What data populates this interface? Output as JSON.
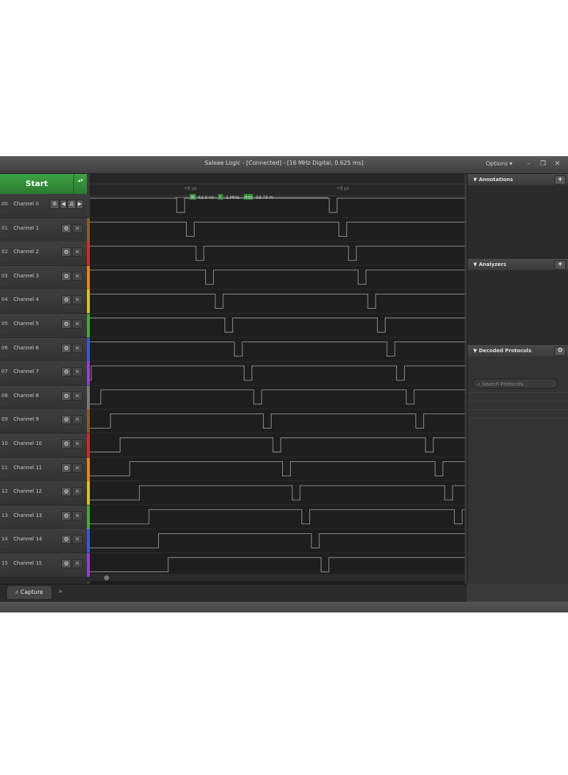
{
  "window": {
    "title": "Saleae Logic - [Connected] - [16 MHz Digital, 0.625 ms]",
    "options_label": "Options ▾",
    "minimize": "–",
    "restore": "❐",
    "close": "✕"
  },
  "start_button": {
    "label": "Start",
    "arrow": "▴▾"
  },
  "ruler": {
    "tick_left": "+8 µs",
    "tick_right": "+9 µs",
    "measure": {
      "w_label": "W",
      "width": "62.5 ns",
      "f_label": "f",
      "freq": "1 MHz",
      "duty_label": "duty",
      "duty": "93.75 %"
    }
  },
  "channels": [
    {
      "num": "00",
      "name": "Channel 0",
      "color": "#3a3a3a"
    },
    {
      "num": "01",
      "name": "Channel 1",
      "color": "#8a5a2a"
    },
    {
      "num": "02",
      "name": "Channel 2",
      "color": "#d22b2b"
    },
    {
      "num": "03",
      "name": "Channel 3",
      "color": "#e58a1c"
    },
    {
      "num": "04",
      "name": "Channel 4",
      "color": "#e0c21a"
    },
    {
      "num": "05",
      "name": "Channel 5",
      "color": "#3fae3a"
    },
    {
      "num": "06",
      "name": "Channel 6",
      "color": "#3a59d1"
    },
    {
      "num": "07",
      "name": "Channel 7",
      "color": "#9b3ed1"
    },
    {
      "num": "08",
      "name": "Channel 8",
      "color": "#7a7a7a"
    },
    {
      "num": "09",
      "name": "Channel 9",
      "color": "#8a5a2a"
    },
    {
      "num": "10",
      "name": "Channel 10",
      "color": "#d22b2b"
    },
    {
      "num": "11",
      "name": "Channel 11",
      "color": "#e58a1c"
    },
    {
      "num": "12",
      "name": "Channel 12",
      "color": "#e0c21a"
    },
    {
      "num": "13",
      "name": "Channel 13",
      "color": "#3fae3a"
    },
    {
      "num": "14",
      "name": "Channel 14",
      "color": "#3a59d1"
    },
    {
      "num": "15",
      "name": "Channel 15",
      "color": "#9b3ed1"
    }
  ],
  "icons": {
    "gear": "⚙",
    "close": "✕",
    "ch0_prev": "◀",
    "ch0_trigger": "Д",
    "ch0_next": "▶"
  },
  "panels": {
    "annotations": "Annotations",
    "analyzers": "Analyzers",
    "decoded": "Decoded Protocols",
    "plus": "+",
    "search_placeholder": "Search Protocols"
  },
  "bottom": {
    "capture_tab": "Capture",
    "more": "»"
  }
}
